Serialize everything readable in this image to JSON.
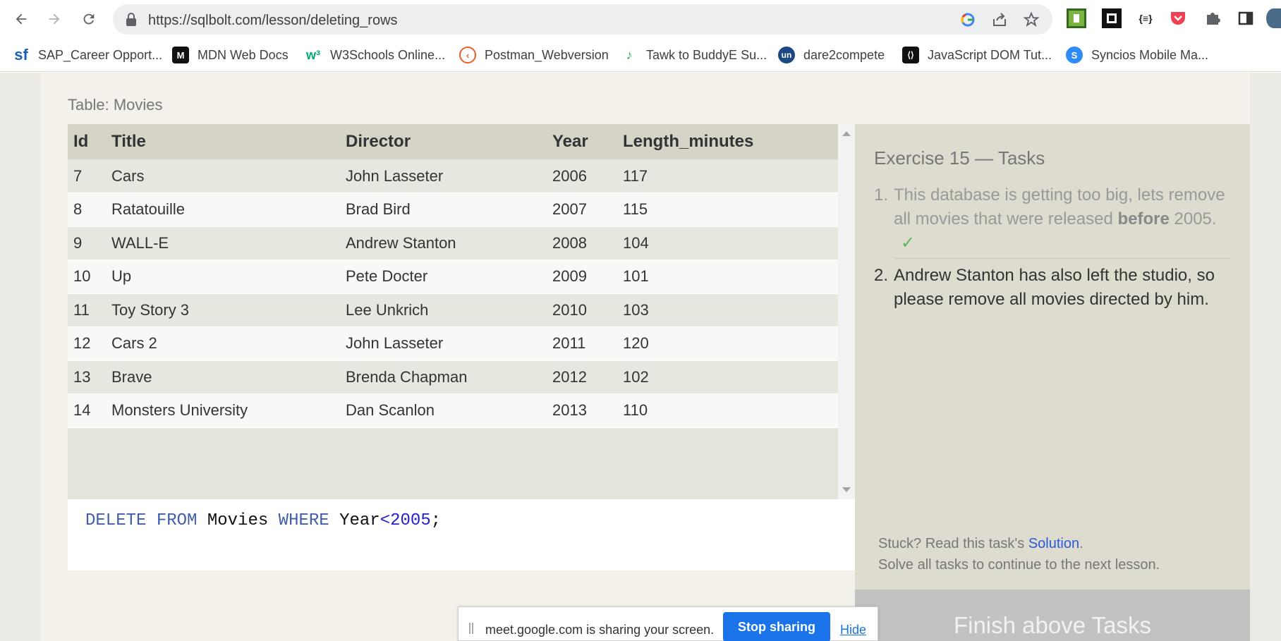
{
  "browser": {
    "url": "https://sqlbolt.com/lesson/deleting_rows",
    "extension_icons": [
      "google-icon",
      "share-icon",
      "star-icon",
      "extension-green-icon",
      "extension-black-icon",
      "json-viewer-icon",
      "pocket-icon",
      "puzzle-icon",
      "sidebar-icon"
    ]
  },
  "bookmarks": [
    {
      "label": "SAP_Career Opport...",
      "icon": "sf-icon"
    },
    {
      "label": "MDN Web Docs",
      "icon": "mdn-icon"
    },
    {
      "label": "W3Schools Online...",
      "icon": "w3schools-icon"
    },
    {
      "label": "Postman_Webversion",
      "icon": "postman-icon"
    },
    {
      "label": "Tawk to BuddyE Su...",
      "icon": "tawk-icon"
    },
    {
      "label": "dare2compete",
      "icon": "unstop-icon"
    },
    {
      "label": "JavaScript DOM Tut...",
      "icon": "javascript-icon"
    },
    {
      "label": "Syncios Mobile Ma...",
      "icon": "syncios-icon"
    }
  ],
  "lesson": {
    "table_caption": "Table: Movies",
    "columns": [
      "Id",
      "Title",
      "Director",
      "Year",
      "Length_minutes"
    ],
    "rows": [
      [
        "7",
        "Cars",
        "John Lasseter",
        "2006",
        "117"
      ],
      [
        "8",
        "Ratatouille",
        "Brad Bird",
        "2007",
        "115"
      ],
      [
        "9",
        "WALL-E",
        "Andrew Stanton",
        "2008",
        "104"
      ],
      [
        "10",
        "Up",
        "Pete Docter",
        "2009",
        "101"
      ],
      [
        "11",
        "Toy Story 3",
        "Lee Unkrich",
        "2010",
        "103"
      ],
      [
        "12",
        "Cars 2",
        "John Lasseter",
        "2011",
        "120"
      ],
      [
        "13",
        "Brave",
        "Brenda Chapman",
        "2012",
        "102"
      ],
      [
        "14",
        "Monsters University",
        "Dan Scanlon",
        "2013",
        "110"
      ]
    ],
    "query": {
      "kw1": "DELETE",
      "kw2": "FROM",
      "table": "Movies",
      "kw3": "WHERE",
      "col": "Year",
      "op": "<",
      "value": "2005",
      "end": ";"
    }
  },
  "tasks": {
    "title": "Exercise 15 — Tasks",
    "items": [
      {
        "num": "1.",
        "before": "This database is getting too big, lets remove all movies that were released ",
        "bold": "before",
        "after": " 2005.",
        "check": "✓",
        "done": true
      },
      {
        "num": "2.",
        "text": "Andrew Stanton has also left the studio, so please remove all movies directed by him.",
        "done": false
      }
    ],
    "stuck_prefix": "Stuck? Read this task's ",
    "solution_link": "Solution",
    "stuck_suffix": ".",
    "continue_text": "Solve all tasks to continue to the next lesson.",
    "finish_button": "Finish above Tasks"
  },
  "sharebar": {
    "message": "meet.google.com is sharing your screen.",
    "stop_label": "Stop sharing",
    "hide_label": "Hide"
  }
}
